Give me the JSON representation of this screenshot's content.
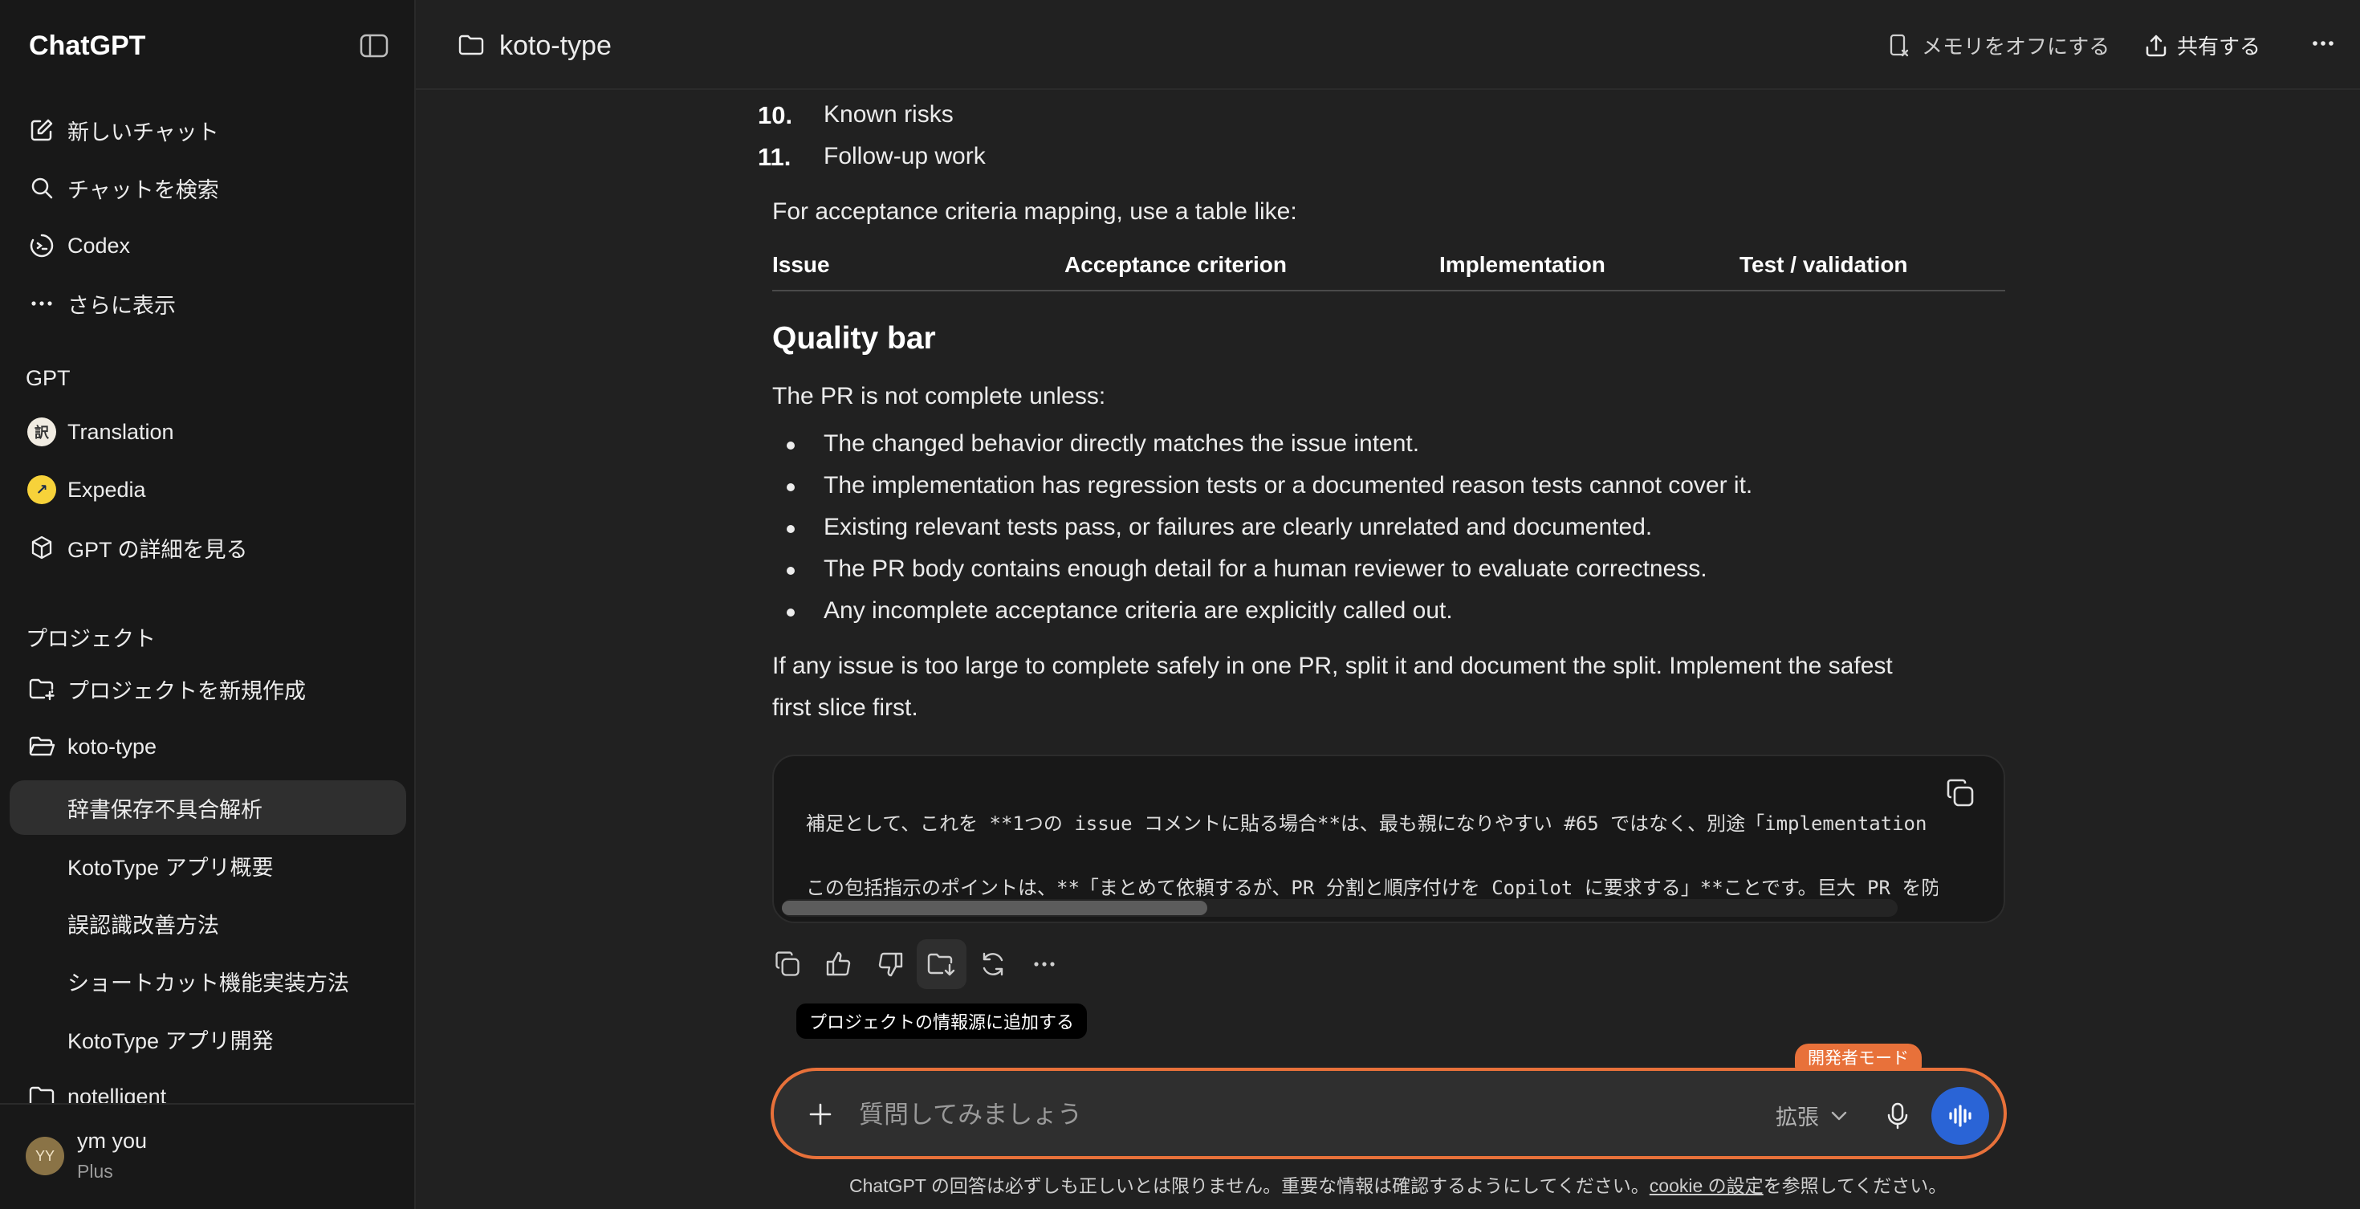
{
  "sidebar": {
    "brand": "ChatGPT",
    "nav": [
      {
        "label": "新しいチャット",
        "icon": "edit-icon"
      },
      {
        "label": "チャットを検索",
        "icon": "search-icon"
      },
      {
        "label": "Codex",
        "icon": "codex-icon"
      },
      {
        "label": "さらに表示",
        "icon": "more-horizontal-icon"
      }
    ],
    "gpt_section_title": "GPT",
    "gpts": [
      {
        "label": "Translation",
        "icon": "translation-icon"
      },
      {
        "label": "Expedia",
        "icon": "expedia-icon"
      },
      {
        "label": "GPT の詳細を見る",
        "icon": "cube-icon"
      }
    ],
    "projects_section_title": "プロジェクト",
    "new_project": "プロジェクトを新規作成",
    "project_name": "koto-type",
    "project_chats": [
      "辞書保存不具合解析",
      "KotoType アプリ概要",
      "誤認識改善方法",
      "ショートカット機能実装方法",
      "KotoType アプリ開発"
    ],
    "next_project": "notelligent",
    "user": {
      "initials": "YY",
      "name": "ym you",
      "plan": "Plus"
    }
  },
  "header": {
    "project_title": "koto-type",
    "memory_off": "メモリをオフにする",
    "share": "共有する"
  },
  "message": {
    "ordered_items": [
      {
        "num": "10.",
        "text": "Known risks"
      },
      {
        "num": "11.",
        "text": "Follow-up work"
      }
    ],
    "table_intro": "For acceptance criteria mapping, use a table like:",
    "table_headers": [
      "Issue",
      "Acceptance criterion",
      "Implementation",
      "Test / validation"
    ],
    "heading": "Quality bar",
    "intro": "The PR is not complete unless:",
    "bullets": [
      "The changed behavior directly matches the issue intent.",
      "The implementation has regression tests or a documented reason tests cannot cover it.",
      "Existing relevant tests pass, or failures are clearly unrelated and documented.",
      "The PR body contains enough detail for a human reviewer to evaluate correctness.",
      "Any incomplete acceptance criteria are explicitly called out."
    ],
    "closing_line1": "If any issue is too large to complete safely in one PR, split it and document the split. Implement the safest",
    "closing_line2": "first slice first.",
    "code_lines": [
      "補足として、これを **1つの issue コメントに貼る場合**は、最も親になりやすい #65 ではなく、別途「implementation coordination",
      "この包括指示のポイントは、**「まとめて依頼するが、PR 分割と順序付けを Copilot に要求する」**ことです。巨大 PR を防ぐために"
    ]
  },
  "actions": {
    "tooltip": "プロジェクトの情報源に追加する"
  },
  "composer": {
    "placeholder": "質問してみましょう",
    "mode_badge": "開発者モード",
    "extension_label": "拡張"
  },
  "footer": {
    "disclaimer_pre": "ChatGPT の回答は必ずしも正しいとは限りません。重要な情報は確認するようにしてください。",
    "cookie_link": "cookie の設定",
    "disclaimer_post": "を参照してください。"
  },
  "colors": {
    "background": "#212121",
    "sidebar": "#181818",
    "accent_orange": "#e8713a",
    "voice_blue": "#2a64d6"
  }
}
